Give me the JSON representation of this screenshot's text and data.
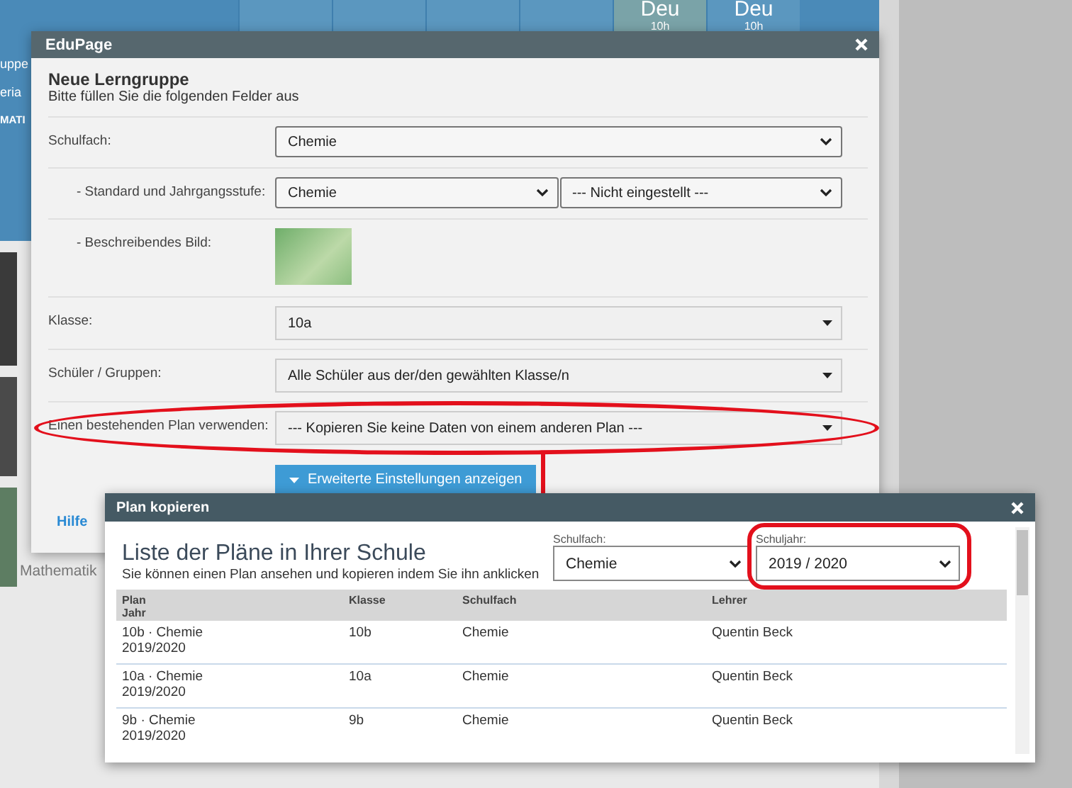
{
  "background": {
    "timetable_cells": [
      {
        "subject": "Deu",
        "duration": "10h",
        "selected": true
      },
      {
        "subject": "Deu",
        "duration": "10h",
        "selected": false
      }
    ],
    "banner_texts": [
      "uppe",
      "eria"
    ],
    "banner_caption": "MATI",
    "course_label": "Mathematik"
  },
  "dialog": {
    "title": "EduPage",
    "heading": "Neue Lerngruppe",
    "subheading": "Bitte füllen Sie die folgenden Felder aus",
    "fields": [
      {
        "kind": "select",
        "label": "Schulfach:",
        "values": [
          "Chemie"
        ],
        "highlighted": false,
        "children": [
          {
            "kind": "select",
            "label": "- Standard und Jahrgangsstufe:",
            "values": [
              "Chemie",
              "--- Nicht eingestellt ---"
            ],
            "highlighted": false
          },
          {
            "kind": "image",
            "label": "- Beschreibendes Bild:",
            "highlighted": false
          }
        ]
      },
      {
        "kind": "dropdown",
        "label": "Klasse:",
        "values": [
          "10a"
        ],
        "highlighted": false
      },
      {
        "kind": "dropdown",
        "label": "Schüler / Gruppen:",
        "values": [
          "Alle Schüler aus der/den gewählten Klasse/n"
        ],
        "highlighted": false
      },
      {
        "kind": "dropdown",
        "label": "Einen bestehenden Plan verwenden:",
        "values": [
          "--- Kopieren Sie keine Daten von einem anderen Plan ---"
        ],
        "highlighted": true
      }
    ],
    "advanced_button": "Erweiterte Einstellungen anzeigen",
    "help_link": "Hilfe"
  },
  "copy_dialog": {
    "title": "Plan kopieren",
    "heading": "Liste der Pläne in Ihrer Schule",
    "subheading": "Sie können einen Plan ansehen und kopieren indem Sie ihn anklicken",
    "filters": [
      {
        "label": "Schulfach:",
        "value": "Chemie",
        "highlighted": false
      },
      {
        "label": "Schuljahr:",
        "value": "2019 / 2020",
        "highlighted": true
      }
    ],
    "table": {
      "columns": [
        {
          "title": "Plan",
          "subtitle": "Jahr"
        },
        {
          "title": "Klasse"
        },
        {
          "title": "Schulfach"
        },
        {
          "title": "Lehrer"
        }
      ],
      "rows": [
        {
          "plan": "10b · Chemie",
          "year": "2019/2020",
          "class": "10b",
          "subject": "Chemie",
          "teacher": "Quentin Beck"
        },
        {
          "plan": "10a · Chemie",
          "year": "2019/2020",
          "class": "10a",
          "subject": "Chemie",
          "teacher": "Quentin Beck"
        },
        {
          "plan": "9b · Chemie",
          "year": "2019/2020",
          "class": "9b",
          "subject": "Chemie",
          "teacher": "Quentin Beck"
        }
      ]
    }
  }
}
